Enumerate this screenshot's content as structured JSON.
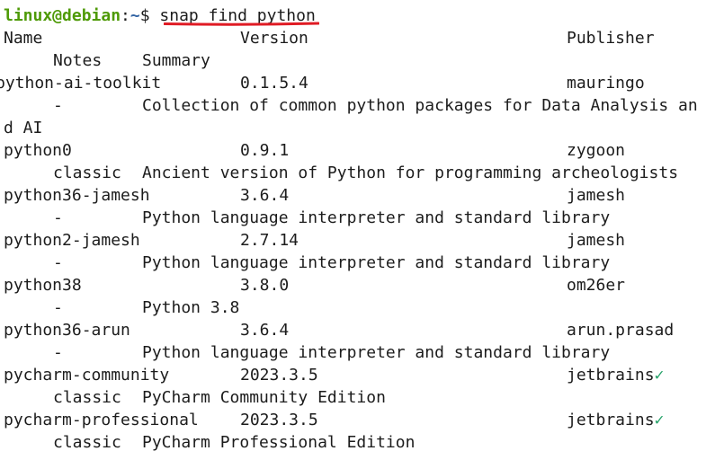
{
  "prompt": {
    "user_host": "linux@debian",
    "separator": ":",
    "path": "~",
    "symbol": "$ ",
    "command": "snap find python"
  },
  "header": {
    "name": "Name",
    "version": "Version",
    "publisher": "Publisher",
    "notes": "Notes",
    "summary": "Summary"
  },
  "colors": {
    "user": "#4e9a06",
    "path": "#3465a4",
    "verified": "#26a269",
    "annotation": "#e01b24"
  },
  "verified_mark": "✓",
  "packages": [
    {
      "name": "python-ai-toolkit",
      "version": "0.1.5.4",
      "publisher": "mauringo",
      "verified": false,
      "notes": "-",
      "summary": "Collection of common python packages for Data Analysis and AI",
      "summary_wrap_1": "Collection of common python packages for Data Analysis an",
      "summary_wrap_2": "d AI"
    },
    {
      "name": "python0",
      "version": "0.9.1",
      "publisher": "zygoon",
      "verified": false,
      "notes": "classic",
      "summary": "Ancient version of Python for programming archeologists"
    },
    {
      "name": "python36-jamesh",
      "version": "3.6.4",
      "publisher": "jamesh",
      "verified": false,
      "notes": "-",
      "summary": "Python language interpreter and standard library"
    },
    {
      "name": "python2-jamesh",
      "version": "2.7.14",
      "publisher": "jamesh",
      "verified": false,
      "notes": "-",
      "summary": "Python language interpreter and standard library"
    },
    {
      "name": "python38",
      "version": "3.8.0",
      "publisher": "om26er",
      "verified": false,
      "notes": "-",
      "summary": "Python 3.8"
    },
    {
      "name": "python36-arun",
      "version": "3.6.4",
      "publisher": "arun.prasad",
      "verified": false,
      "notes": "-",
      "summary": "Python language interpreter and standard library"
    },
    {
      "name": "pycharm-community",
      "version": "2023.3.5",
      "publisher": "jetbrains",
      "verified": true,
      "notes": "classic",
      "summary": "PyCharm Community Edition"
    },
    {
      "name": "pycharm-professional",
      "version": "2023.3.5",
      "publisher": "jetbrains",
      "verified": true,
      "notes": "classic",
      "summary": "PyCharm Professional Edition"
    }
  ]
}
